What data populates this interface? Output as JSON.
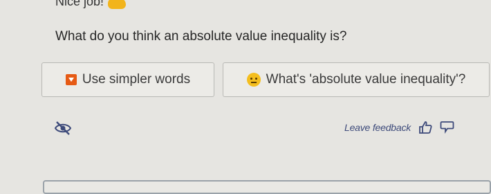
{
  "header": {
    "text": "Nice job!",
    "icon": "hand-icon"
  },
  "question": {
    "text": "What do you think an absolute value inequality is?"
  },
  "buttons": {
    "simpler": {
      "label": "Use simpler words",
      "icon": "down-arrow-icon",
      "icon_color": "#e65a14"
    },
    "what": {
      "label": "What's 'absolute value inequality'?",
      "icon": "thinking-face-icon",
      "icon_color": "#f4be1e"
    }
  },
  "footer": {
    "hide_icon": "eye-slash-icon",
    "feedback_label": "Leave feedback",
    "thumbs_up_icon": "thumbs-up-icon",
    "thumbs_down_icon": "thumbs-down-icon",
    "accent": "#3d4a7a"
  }
}
